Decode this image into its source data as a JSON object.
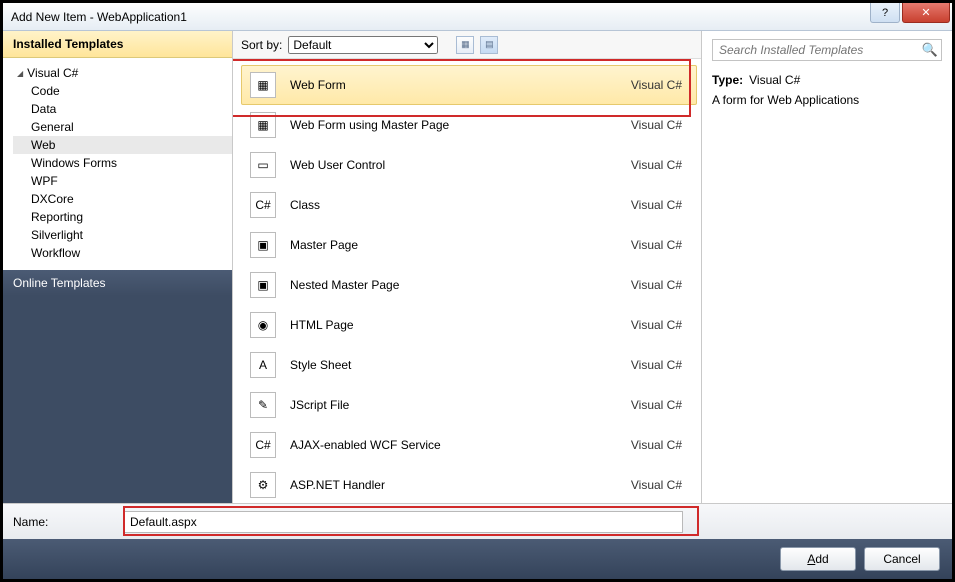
{
  "window": {
    "title": "Add New Item - WebApplication1"
  },
  "sidebar": {
    "installed_header": "Installed Templates",
    "online_header": "Online Templates",
    "root": "Visual C#",
    "items": [
      "Code",
      "Data",
      "General",
      "Web",
      "Windows Forms",
      "WPF",
      "DXCore",
      "Reporting",
      "Silverlight",
      "Workflow"
    ],
    "selected_index": 3
  },
  "sortbar": {
    "label": "Sort by:",
    "selected": "Default"
  },
  "templates": {
    "language": "Visual C#",
    "selected_index": 0,
    "items": [
      {
        "name": "Web Form",
        "icon": "form-icon"
      },
      {
        "name": "Web Form using Master Page",
        "icon": "form-icon"
      },
      {
        "name": "Web User Control",
        "icon": "control-icon"
      },
      {
        "name": "Class",
        "icon": "class-icon"
      },
      {
        "name": "Master Page",
        "icon": "master-icon"
      },
      {
        "name": "Nested Master Page",
        "icon": "master-icon"
      },
      {
        "name": "HTML Page",
        "icon": "html-icon"
      },
      {
        "name": "Style Sheet",
        "icon": "css-icon"
      },
      {
        "name": "JScript File",
        "icon": "js-icon"
      },
      {
        "name": "AJAX-enabled WCF Service",
        "icon": "wcf-icon"
      },
      {
        "name": "ASP.NET Handler",
        "icon": "handler-icon"
      }
    ]
  },
  "details": {
    "search_placeholder": "Search Installed Templates",
    "type_label": "Type:",
    "type_value": "Visual C#",
    "description": "A form for Web Applications"
  },
  "name_row": {
    "label": "Name:",
    "value": "Default.aspx"
  },
  "buttons": {
    "add": "Add",
    "cancel": "Cancel"
  }
}
